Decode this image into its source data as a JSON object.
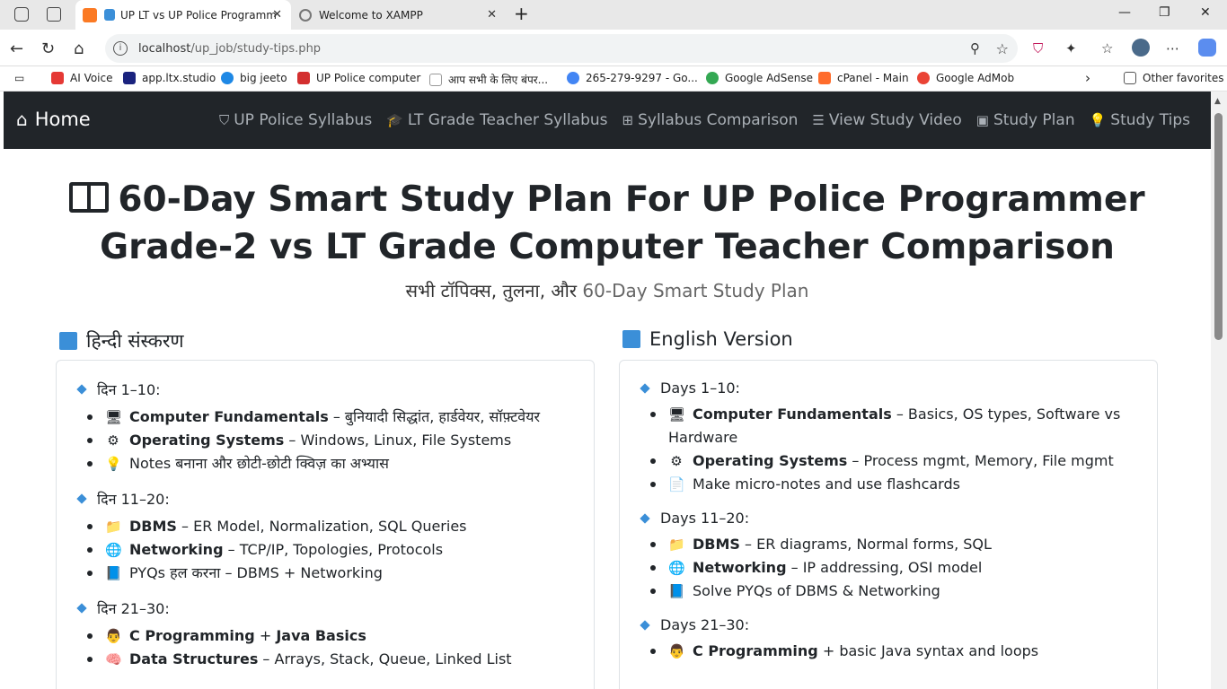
{
  "browser": {
    "tabs": [
      {
        "title": "UP LT vs UP Police Programm",
        "active": true
      },
      {
        "title": "Welcome to XAMPP",
        "active": false
      }
    ],
    "url_host": "localhost",
    "url_path": "/up_job/study-tips.php",
    "bookmarks": [
      "AI Voice",
      "app.ltx.studio",
      "big jeeto",
      "UP Police computer",
      "आप सभी के लिए बंपर...",
      "265-279-9297 - Go...",
      "Google AdSense",
      "cPanel - Main",
      "Google AdMob"
    ],
    "other_favorites": "Other favorites"
  },
  "nav": {
    "brand": "Home",
    "links": [
      "UP Police Syllabus",
      "LT Grade Teacher Syllabus",
      "Syllabus Comparison",
      "View Study Video",
      "Study Plan",
      "Study Tips"
    ]
  },
  "page": {
    "title_line1": "60-Day Smart Study Plan For UP Police Programmer",
    "title_line2": "Grade-2 vs LT Grade Computer Teacher Comparison",
    "subtitle_hi": "सभी टॉपिक्स, तुलना, और ",
    "subtitle_en": "60-Day Smart Study Plan"
  },
  "hindi": {
    "heading": "हिन्दी संस्करण",
    "sections": [
      {
        "label": "दिन 1–10:",
        "items": [
          {
            "emoji": "🖥",
            "bold": "Computer Fundamentals",
            "rest": " – बुनियादी सिद्धांत, हार्डवेयर, सॉफ़्टवेयर"
          },
          {
            "emoji": "⚙",
            "bold": "Operating Systems",
            "rest": " – Windows, Linux, File Systems"
          },
          {
            "emoji": "💡",
            "bold": "",
            "rest": "Notes बनाना और छोटी-छोटी क्विज़ का अभ्यास"
          }
        ]
      },
      {
        "label": "दिन 11–20:",
        "items": [
          {
            "emoji": "📁",
            "bold": "DBMS",
            "rest": " – ER Model, Normalization, SQL Queries"
          },
          {
            "emoji": "🌐",
            "bold": "Networking",
            "rest": " – TCP/IP, Topologies, Protocols"
          },
          {
            "emoji": "📘",
            "bold": "",
            "rest": "PYQs हल करना – DBMS + Networking"
          }
        ]
      },
      {
        "label": "दिन 21–30:",
        "items": [
          {
            "emoji": "👨",
            "bold": "C Programming",
            "rest": " + ",
            "bold2": "Java Basics"
          },
          {
            "emoji": "🧠",
            "bold": "Data Structures",
            "rest": " – Arrays, Stack, Queue, Linked List"
          }
        ]
      }
    ]
  },
  "english": {
    "heading": "English Version",
    "sections": [
      {
        "label": "Days 1–10:",
        "items": [
          {
            "emoji": "🖥",
            "bold": "Computer Fundamentals",
            "rest": " – Basics, OS types, Software vs Hardware"
          },
          {
            "emoji": "⚙",
            "bold": "Operating Systems",
            "rest": " – Process mgmt, Memory, File mgmt"
          },
          {
            "emoji": "📄",
            "bold": "",
            "rest": "Make micro-notes and use flashcards"
          }
        ]
      },
      {
        "label": "Days 11–20:",
        "items": [
          {
            "emoji": "📁",
            "bold": "DBMS",
            "rest": " – ER diagrams, Normal forms, SQL"
          },
          {
            "emoji": "🌐",
            "bold": "Networking",
            "rest": " – IP addressing, OSI model"
          },
          {
            "emoji": "📘",
            "bold": "",
            "rest": "Solve PYQs of DBMS & Networking"
          }
        ]
      },
      {
        "label": "Days 21–30:",
        "items": [
          {
            "emoji": "👨",
            "bold": "C Programming",
            "rest": " + basic Java syntax and loops"
          }
        ]
      }
    ]
  }
}
